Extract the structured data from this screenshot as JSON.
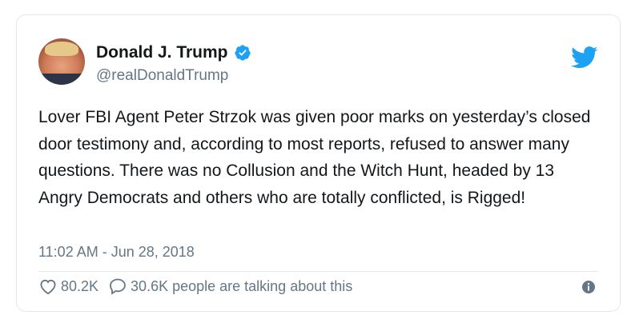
{
  "author": {
    "display_name": "Donald J. Trump",
    "handle": "@realDonaldTrump",
    "verified": true
  },
  "tweet": {
    "text": "Lover FBI Agent Peter Strzok was given poor marks on yesterday’s closed door testimony and, according to most reports, refused to answer many questions. There was no Collusion and the Witch Hunt, headed by 13 Angry Democrats and others who are totally conflicted, is Rigged!",
    "timestamp": "11:02 AM - Jun 28, 2018"
  },
  "actions": {
    "likes": "80.2K",
    "talking": "30.6K people are talking about this"
  },
  "icons": {
    "logo": "twitter-bird-icon",
    "verified": "verified-badge-icon",
    "like": "heart-icon",
    "reply": "speech-bubble-icon",
    "info": "info-icon"
  },
  "colors": {
    "brand": "#1da1f2",
    "text": "#14171a",
    "secondary": "#657786",
    "border": "#e1e8ed"
  }
}
